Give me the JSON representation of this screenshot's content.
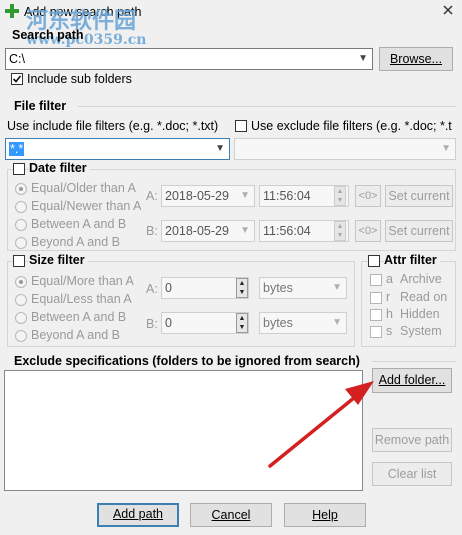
{
  "window": {
    "title": "Add new search path"
  },
  "watermark": {
    "line1": "河东软件园",
    "line2": "www.pc0359.cn"
  },
  "search_path": {
    "label": "Search path",
    "value": "C:\\",
    "browse_label": "Browse...",
    "include_sub_label": "Include sub folders",
    "include_sub_checked": true
  },
  "file_filter": {
    "label": "File filter",
    "use_include_label": "Use include file filters (e.g. *.doc; *.txt)",
    "use_exclude_label": "Use exclude file filters (e.g. *.doc; *.t",
    "include_value": "*.*",
    "exclude_value": ""
  },
  "date_filter": {
    "label": "Date filter",
    "options": [
      "Equal/Older than A",
      "Equal/Newer than A",
      "Between A and B",
      "Beyond A and B"
    ],
    "a_label": "A:",
    "b_label": "B:",
    "a_date": "2018-05-29",
    "a_time": "11:56:04",
    "b_date": "2018-05-29",
    "b_time": "11:56:04",
    "zero_label": "<0>",
    "set_current_label": "Set current"
  },
  "size_filter": {
    "label": "Size filter",
    "options": [
      "Equal/More than A",
      "Equal/Less than A",
      "Between A and B",
      "Beyond A and B"
    ],
    "a_label": "A:",
    "b_label": "B:",
    "a_value": "0",
    "b_value": "0",
    "a_unit": "bytes",
    "b_unit": "bytes"
  },
  "attr_filter": {
    "label": "Attr filter",
    "items": [
      {
        "key": "a",
        "label": "Archive"
      },
      {
        "key": "r",
        "label": "Read on"
      },
      {
        "key": "h",
        "label": "Hidden"
      },
      {
        "key": "s",
        "label": "System"
      }
    ]
  },
  "exclude": {
    "label": "Exclude specifications (folders to be ignored from search)",
    "add_folder_label": "Add folder...",
    "remove_path_label": "Remove path",
    "clear_list_label": "Clear list"
  },
  "footer": {
    "add_path_label": "Add path",
    "cancel_label": "Cancel",
    "help_label": "Help"
  },
  "colors": {
    "arrow": "#d42020",
    "accent": "#3c7fb1",
    "watermark": "#6aa6d6"
  }
}
